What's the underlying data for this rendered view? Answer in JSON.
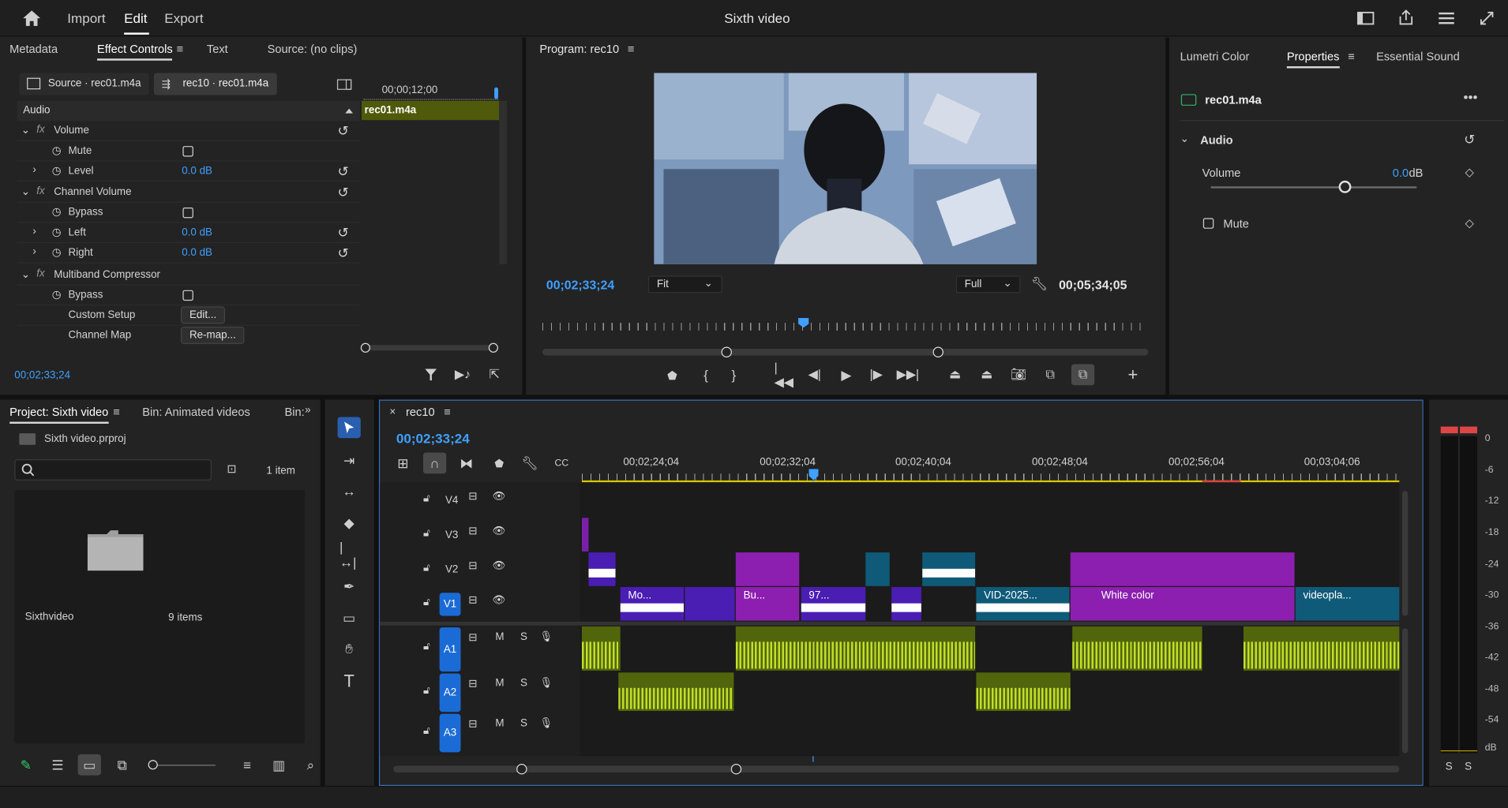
{
  "topbar": {
    "home_icon": "home-icon",
    "tabs": [
      "Import",
      "Edit",
      "Export"
    ],
    "active_tab": "Edit",
    "title": "Sixth video"
  },
  "effect_controls": {
    "tabs": [
      "Metadata",
      "Effect Controls",
      "Text",
      "Source: (no clips)"
    ],
    "source_tab": "Source · rec01.m4a",
    "seq_tab": "rec10 · rec01.m4a",
    "timecode_ruler": "00;00;12;00",
    "clip_label": "rec01.m4a",
    "section": "Audio",
    "rows": [
      {
        "name": "Volume",
        "type": "fx"
      },
      {
        "name": "Mute",
        "type": "check"
      },
      {
        "name": "Level",
        "type": "value",
        "value": "0.0 dB"
      },
      {
        "name": "Channel Volume",
        "type": "fx"
      },
      {
        "name": "Bypass",
        "type": "check"
      },
      {
        "name": "Left",
        "type": "value",
        "value": "0.0 dB"
      },
      {
        "name": "Right",
        "type": "value",
        "value": "0.0 dB"
      },
      {
        "name": "Multiband Compressor",
        "type": "fx"
      },
      {
        "name": "Bypass",
        "type": "check"
      },
      {
        "name": "Custom Setup",
        "type": "button",
        "value": "Edit..."
      },
      {
        "name": "Channel Map",
        "type": "button",
        "value": "Re-map..."
      }
    ],
    "current_time": "00;02;33;24"
  },
  "program": {
    "title": "Program: rec10",
    "timecode": "00;02;33;24",
    "fit": "Fit",
    "quality": "Full",
    "duration": "00;05;34;05"
  },
  "properties": {
    "tabs": [
      "Lumetri Color",
      "Properties",
      "Essential Sound"
    ],
    "clip": "rec01.m4a",
    "section": "Audio",
    "volume_label": "Volume",
    "volume_value": "0.0",
    "volume_unit": "dB",
    "mute_label": "Mute"
  },
  "project": {
    "tabs": [
      "Project: Sixth video",
      "Bin: Animated videos",
      "Bin:"
    ],
    "file": "Sixth video.prproj",
    "count": "1 item",
    "folder_name": "Sixthvideo",
    "folder_items": "9 items"
  },
  "timeline": {
    "seq": "rec10",
    "timecode": "00;02;33;24",
    "ruler": [
      "00;02;24;04",
      "00;02;32;04",
      "00;02;40;04",
      "00;02;48;04",
      "00;02;56;04",
      "00;03;04;06"
    ],
    "video_tracks": [
      "V4",
      "V3",
      "V2",
      "V1"
    ],
    "audio_tracks": [
      "A1",
      "A2",
      "A3"
    ],
    "clips": [
      "Mo...",
      "Bu...",
      "97...",
      "VID-2025...",
      "White color",
      "videopla..."
    ],
    "m_label": "M",
    "s_label": "S"
  },
  "meter": {
    "labels": [
      "0",
      "-6",
      "-12",
      "-18",
      "-24",
      "-30",
      "-36",
      "-42",
      "-48",
      "-54",
      "dB"
    ],
    "solo": [
      "S",
      "S"
    ]
  }
}
